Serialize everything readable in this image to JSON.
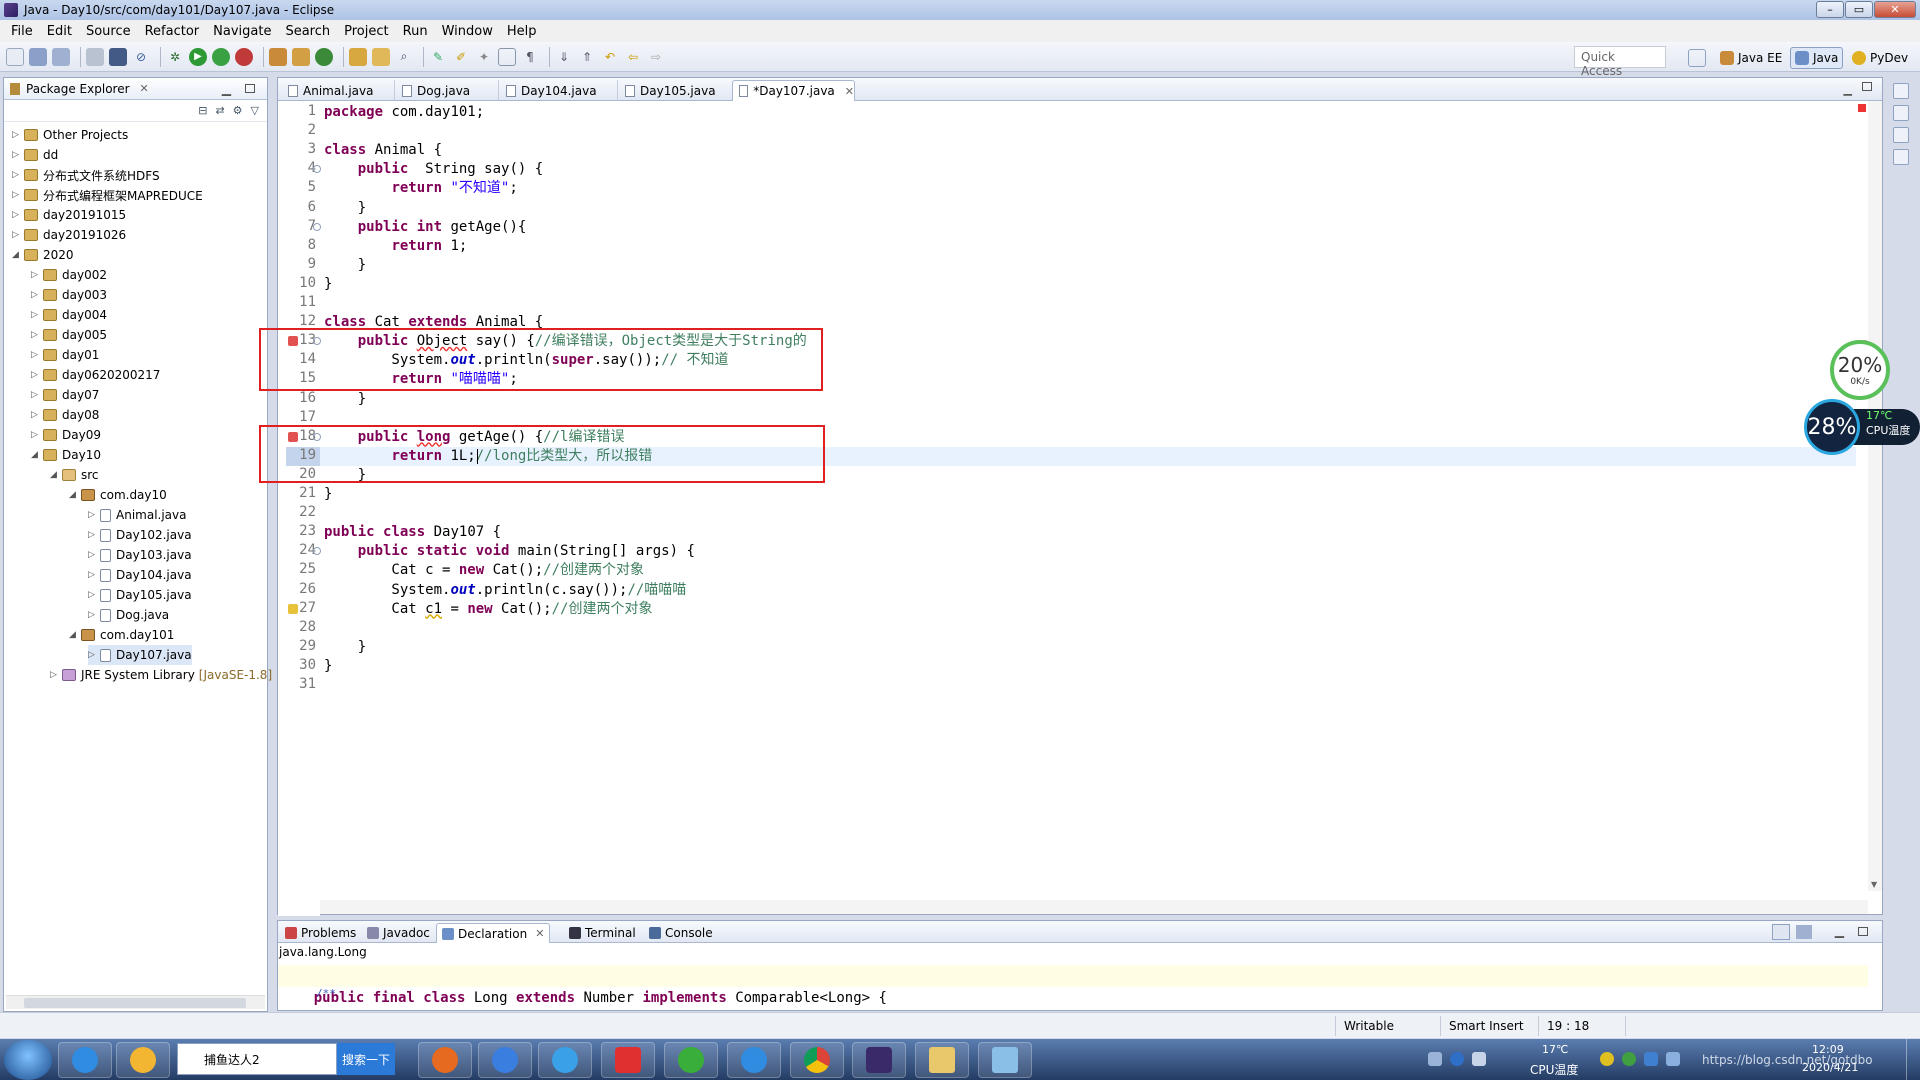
{
  "window": {
    "title": "Java - Day10/src/com/day101/Day107.java - Eclipse",
    "controls": [
      "–",
      "▭",
      "✕"
    ]
  },
  "menu": [
    "File",
    "Edit",
    "Source",
    "Refactor",
    "Navigate",
    "Search",
    "Project",
    "Run",
    "Window",
    "Help"
  ],
  "toolbar": {
    "quick_access": "Quick Access",
    "perspectives": [
      "Java EE",
      "Java",
      "PyDev"
    ]
  },
  "package_explorer": {
    "title": "Package Explorer",
    "items": [
      {
        "label": "Other Projects",
        "depth": 0,
        "icon": "project"
      },
      {
        "label": "dd",
        "depth": 0,
        "icon": "project"
      },
      {
        "label": "分布式文件系统HDFS",
        "depth": 0,
        "icon": "project"
      },
      {
        "label": "分布式编程框架MAPREDUCE",
        "depth": 0,
        "icon": "project"
      },
      {
        "label": "day20191015",
        "depth": 0,
        "icon": "project"
      },
      {
        "label": "day20191026",
        "depth": 0,
        "icon": "project"
      },
      {
        "label": "2020",
        "depth": 0,
        "icon": "project"
      },
      {
        "label": "day002",
        "depth": 1,
        "icon": "project"
      },
      {
        "label": "day003",
        "depth": 1,
        "icon": "project"
      },
      {
        "label": "day004",
        "depth": 1,
        "icon": "project"
      },
      {
        "label": "day005",
        "depth": 1,
        "icon": "project"
      },
      {
        "label": "day01",
        "depth": 1,
        "icon": "project"
      },
      {
        "label": "day0620200217",
        "depth": 1,
        "icon": "project"
      },
      {
        "label": "day07",
        "depth": 1,
        "icon": "project"
      },
      {
        "label": "day08",
        "depth": 1,
        "icon": "project"
      },
      {
        "label": "Day09",
        "depth": 1,
        "icon": "project"
      },
      {
        "label": "Day10",
        "depth": 1,
        "icon": "project"
      },
      {
        "label": "src",
        "depth": 2,
        "icon": "source-folder"
      },
      {
        "label": "com.day10",
        "depth": 3,
        "icon": "package"
      },
      {
        "label": "Animal.java",
        "depth": 4,
        "icon": "java-file"
      },
      {
        "label": "Day102.java",
        "depth": 4,
        "icon": "java-file"
      },
      {
        "label": "Day103.java",
        "depth": 4,
        "icon": "java-file"
      },
      {
        "label": "Day104.java",
        "depth": 4,
        "icon": "java-file"
      },
      {
        "label": "Day105.java",
        "depth": 4,
        "icon": "java-file"
      },
      {
        "label": "Dog.java",
        "depth": 4,
        "icon": "java-file"
      },
      {
        "label": "com.day101",
        "depth": 3,
        "icon": "package"
      },
      {
        "label": "Day107.java",
        "depth": 4,
        "icon": "java-file"
      },
      {
        "label": "JRE System Library",
        "depth": 2,
        "icon": "library",
        "suffix": "[JavaSE-1.8]"
      }
    ]
  },
  "editor": {
    "tabs": [
      "Animal.java",
      "Dog.java",
      "Day104.java",
      "Day105.java",
      "*Day107.java"
    ],
    "active_tab": 4,
    "current_line": 19
  },
  "bottom_panel": {
    "tabs": [
      "Problems",
      "Javadoc",
      "Declaration",
      "Terminal",
      "Console"
    ],
    "active_tab": "Declaration",
    "declaration_name": "java.lang.Long",
    "declaration_code": "public final class Long extends Number implements Comparable<Long> {",
    "declaration_code_next": "/**"
  },
  "status": {
    "writable": "Writable",
    "insert_mode": "Smart Insert",
    "position": "19 : 18"
  },
  "overlays": {
    "net_percent": "20%",
    "net_speed": "0K/s",
    "cpu_percent": "28%",
    "cpu_temp": "17℃",
    "cpu_label": "CPU温度"
  },
  "taskbar": {
    "search_text": "捕鱼达人2",
    "search_button": "搜索一下",
    "tray_temp": "17℃",
    "tray_temp_label": "CPU温度",
    "watermark": "https://blog.csdn.net/gotdbo",
    "time": "12:09",
    "date": "2020/4/21"
  }
}
